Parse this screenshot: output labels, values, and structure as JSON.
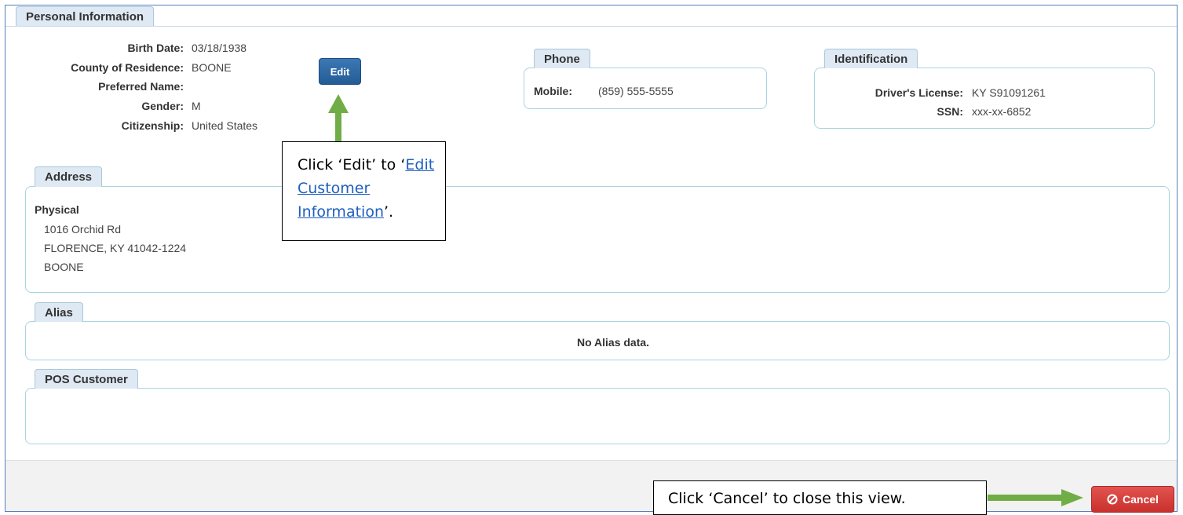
{
  "personal": {
    "tab": "Personal Information",
    "fields": [
      {
        "label": "Birth Date:",
        "value": "03/18/1938"
      },
      {
        "label": "County of Residence:",
        "value": "BOONE"
      },
      {
        "label": "Preferred Name:",
        "value": ""
      },
      {
        "label": "Gender:",
        "value": "M"
      },
      {
        "label": "Citizenship:",
        "value": "United States"
      }
    ],
    "edit_label": "Edit"
  },
  "phone": {
    "tab": "Phone",
    "label": "Mobile:",
    "value": "(859) 555-5555"
  },
  "identification": {
    "tab": "Identification",
    "fields": [
      {
        "label": "Driver's License:",
        "value": "KY S91091261"
      },
      {
        "label": "SSN:",
        "value": "xxx-xx-6852"
      }
    ]
  },
  "address": {
    "tab": "Address",
    "type": "Physical",
    "lines": [
      "1016 Orchid Rd",
      "FLORENCE, KY 41042-1224",
      "BOONE"
    ]
  },
  "alias": {
    "tab": "Alias",
    "empty_text": "No Alias data."
  },
  "pos": {
    "tab": "POS Customer"
  },
  "callouts": {
    "edit": {
      "prefix": "Click ‘Edit’ to ‘",
      "link": "Edit Customer Information",
      "suffix": "’."
    },
    "cancel": "Click ‘Cancel’ to close this view."
  },
  "footer": {
    "cancel_label": "Cancel"
  },
  "colors": {
    "edit_button": "#2a6399",
    "cancel_button": "#d9423f",
    "arrow": "#70ad47",
    "panel_border": "#a8d4e0"
  }
}
